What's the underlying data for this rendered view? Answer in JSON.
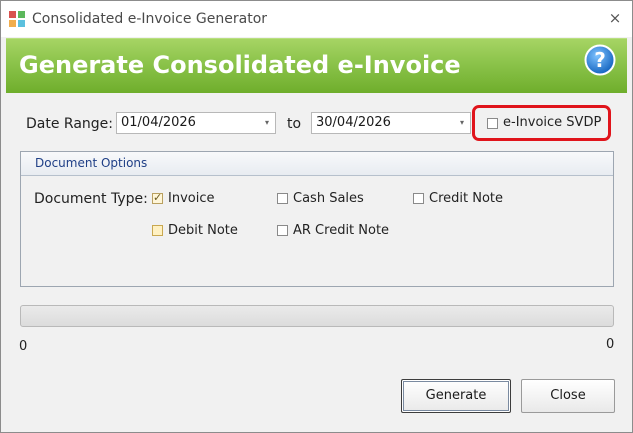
{
  "window": {
    "title": "Consolidated e-Invoice Generator",
    "close_glyph": "×"
  },
  "banner": {
    "title": "Generate Consolidated e-Invoice",
    "help_glyph": "?"
  },
  "date_range": {
    "label": "Date Range:",
    "from_value": "01/04/2026",
    "to_label": "to",
    "to_value": "30/04/2026",
    "dropdown_glyph": "▾"
  },
  "svdp": {
    "label": "e-Invoice SVDP",
    "checked": false
  },
  "document_options": {
    "title": "Document Options",
    "type_label": "Document Type:",
    "types": [
      {
        "label": "Invoice",
        "checked": true
      },
      {
        "label": "Cash Sales",
        "checked": false
      },
      {
        "label": "Credit Note",
        "checked": false
      },
      {
        "label": "Debit Note",
        "checked": false
      },
      {
        "label": "AR Credit Note",
        "checked": false
      }
    ]
  },
  "progress": {
    "min_label": "0",
    "max_label": "0",
    "fraction": 0
  },
  "buttons": {
    "generate_label": "Generate",
    "close_label": "Close"
  },
  "colors": {
    "banner_green": "#8bc34a",
    "highlight_red": "#e0141b",
    "group_title_blue": "#1f3f86"
  }
}
